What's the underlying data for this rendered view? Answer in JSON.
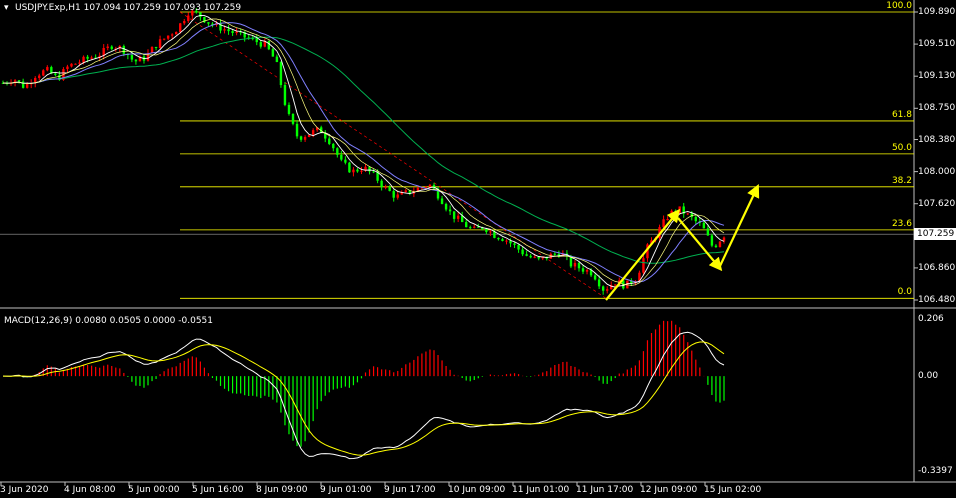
{
  "header": {
    "symbol_info": "USDJPY.Exp,H1  107.094 107.259 107.093 107.259",
    "macd_info": "MACD(12,26,9) 0.0080 0.0505 0.0000 -0.0551"
  },
  "price_axis": [
    "109.890",
    "109.510",
    "109.130",
    "108.750",
    "108.380",
    "108.000",
    "107.620",
    "107.240",
    "106.860",
    "106.480"
  ],
  "current_price": "107.259",
  "macd_axis": [
    "0.206",
    "0.00",
    "-0.3397"
  ],
  "time_axis": [
    "3 Jun 2020",
    "4 Jun 08:00",
    "5 Jun 00:00",
    "5 Jun 16:00",
    "8 Jun 09:00",
    "9 Jun 01:00",
    "9 Jun 17:00",
    "10 Jun 09:00",
    "11 Jun 01:00",
    "11 Jun 17:00",
    "12 Jun 09:00",
    "15 Jun 02:00"
  ],
  "fib_levels": [
    {
      "label": "100.0",
      "price": 109.89
    },
    {
      "label": "61.8",
      "price": 108.6
    },
    {
      "label": "50.0",
      "price": 108.21
    },
    {
      "label": "38.2",
      "price": 107.82
    },
    {
      "label": "23.6",
      "price": 107.31
    },
    {
      "label": "0.0",
      "price": 106.5
    }
  ],
  "colors": {
    "background": "#000000",
    "bull_candle": "#ff0000",
    "bear_candle": "#00ff00",
    "fib": "#ffff00",
    "ma_fast": "#ffffff",
    "ma_slow": "#00b050",
    "ma_mid": "#8080ff",
    "macd_line": "#ffffff",
    "signal_line": "#ffff00",
    "arrow": "#ffff00"
  },
  "chart_data": {
    "type": "candlestick",
    "symbol": "USDJPY.Exp",
    "timeframe": "H1",
    "ylim": [
      106.48,
      109.89
    ],
    "close_path": [
      109.05,
      109.1,
      109.0,
      109.15,
      109.2,
      109.1,
      109.25,
      109.3,
      109.35,
      109.4,
      109.5,
      109.45,
      109.3,
      109.35,
      109.5,
      109.6,
      109.7,
      109.9,
      109.85,
      109.75,
      109.7,
      109.65,
      109.6,
      109.55,
      109.5,
      109.3,
      108.7,
      108.4,
      108.45,
      108.5,
      108.35,
      108.1,
      108.0,
      108.05,
      107.95,
      107.8,
      107.7,
      107.75,
      107.8,
      107.85,
      107.7,
      107.5,
      107.4,
      107.3,
      107.35,
      107.25,
      107.2,
      107.1,
      107.0,
      106.95,
      107.0,
      107.05,
      106.9,
      106.85,
      106.8,
      106.6,
      106.7,
      106.65,
      106.75,
      107.1,
      107.3,
      107.5,
      107.55,
      107.45,
      107.35,
      107.1,
      107.25
    ],
    "macd_ylim": [
      -0.3397,
      0.206
    ]
  }
}
